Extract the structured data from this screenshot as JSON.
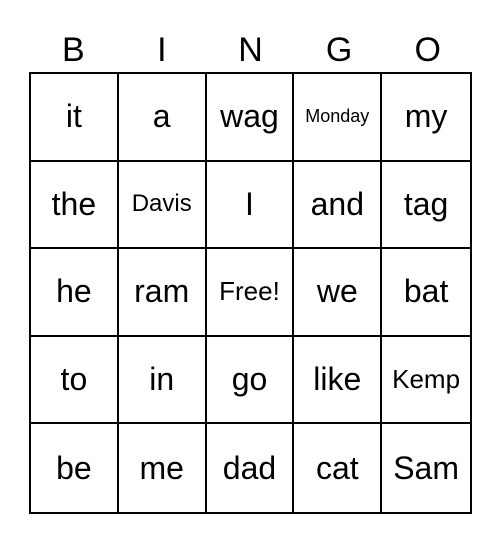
{
  "header": [
    "B",
    "I",
    "N",
    "G",
    "O"
  ],
  "cells": [
    [
      "it",
      "a",
      "wag",
      "Monday",
      "my"
    ],
    [
      "the",
      "Davis",
      "I",
      "and",
      "tag"
    ],
    [
      "he",
      "ram",
      "Free!",
      "we",
      "bat"
    ],
    [
      "to",
      "in",
      "go",
      "like",
      "Kemp"
    ],
    [
      "be",
      "me",
      "dad",
      "cat",
      "Sam"
    ]
  ]
}
